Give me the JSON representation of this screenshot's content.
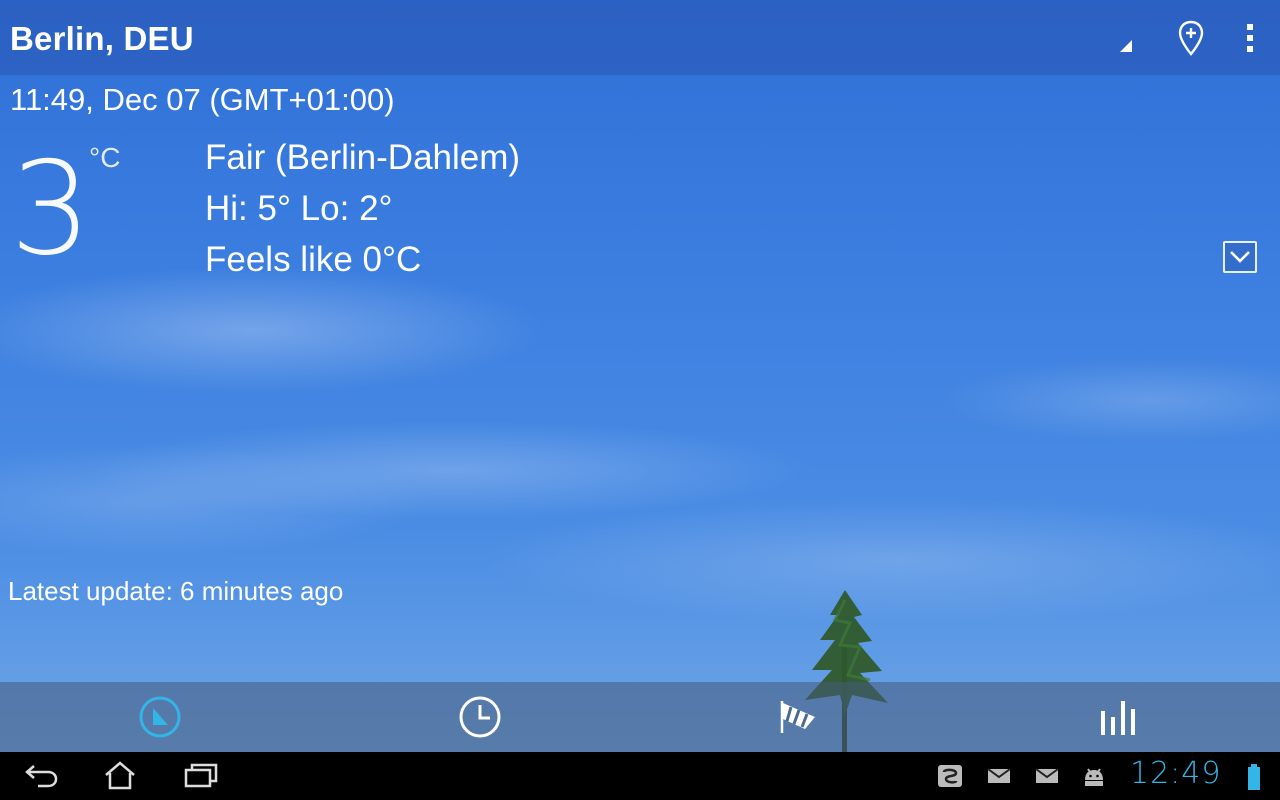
{
  "header": {
    "city": "Berlin, DEU",
    "icons": [
      "signal-icon",
      "add-location-icon",
      "overflow-menu-icon"
    ]
  },
  "current": {
    "datetime": "11:49, Dec 07 (GMT+01:00)",
    "temperature": "3",
    "unit": "°C",
    "condition": "Fair (Berlin-Dahlem)",
    "hilo": "Hi: 5°  Lo: 2°",
    "feels_like": "Feels like 0°C",
    "latest_update": "Latest update: 6 minutes ago"
  },
  "tabs": [
    {
      "name": "current-conditions",
      "icon": "compass-icon",
      "active": true
    },
    {
      "name": "hourly",
      "icon": "clock-icon",
      "active": false
    },
    {
      "name": "wind",
      "icon": "windsock-icon",
      "active": false
    },
    {
      "name": "charts",
      "icon": "bar-chart-icon",
      "active": false
    }
  ],
  "system_bar": {
    "clock": "12:49",
    "nav": [
      "back-icon",
      "home-icon",
      "recent-apps-icon"
    ],
    "notifications": [
      "app-notification-icon",
      "email-icon",
      "email-icon",
      "android-icon"
    ],
    "accent": "#33b5e5"
  }
}
